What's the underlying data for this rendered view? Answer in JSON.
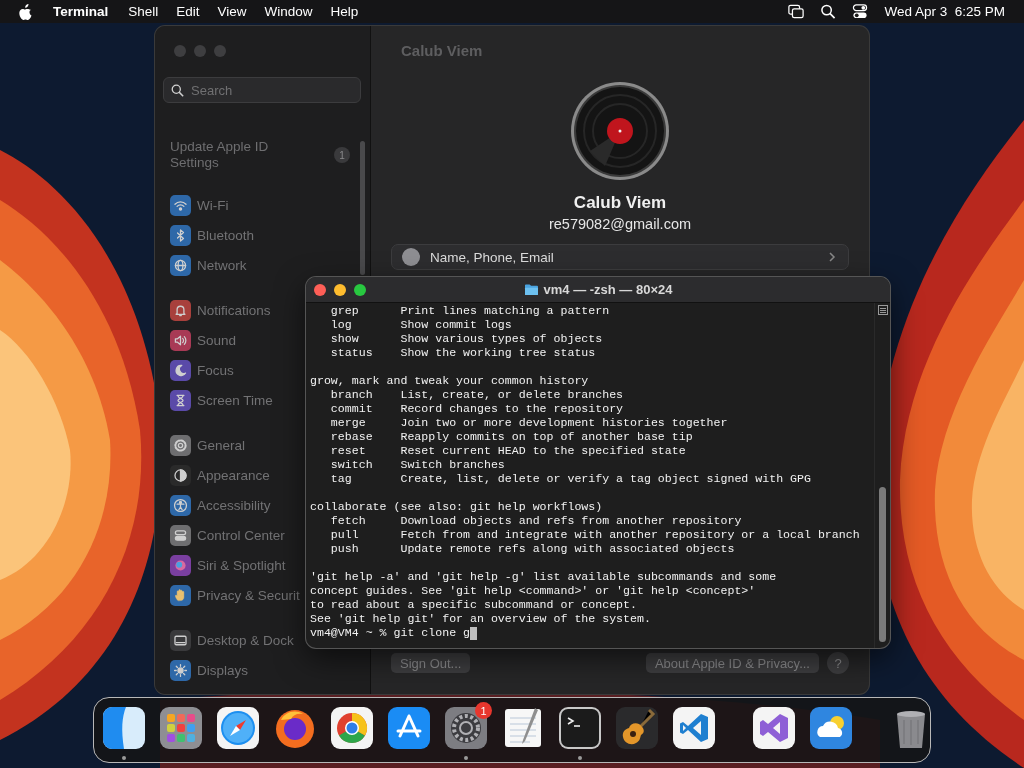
{
  "menu_bar": {
    "app": "Terminal",
    "menus": [
      "Shell",
      "Edit",
      "View",
      "Window",
      "Help"
    ],
    "clock": "Wed Apr 3  6:25 PM"
  },
  "settings_window": {
    "search": {
      "placeholder": "Search"
    },
    "account_item": {
      "label": "Update Apple ID Settings",
      "badge": "1"
    },
    "sidebar": {
      "groups": [
        [
          {
            "label": "Wi-Fi",
            "kind": "wifi",
            "color": "#2e68a8"
          },
          {
            "label": "Bluetooth",
            "kind": "bluetooth",
            "color": "#2e68a8"
          },
          {
            "label": "Network",
            "kind": "globe",
            "color": "#2e68a8"
          }
        ],
        [
          {
            "label": "Notifications",
            "kind": "bell",
            "color": "#a8403c"
          },
          {
            "label": "Sound",
            "kind": "speaker",
            "color": "#a83a55"
          },
          {
            "label": "Focus",
            "kind": "moon",
            "color": "#5a4aa8"
          },
          {
            "label": "Screen Time",
            "kind": "hourglass",
            "color": "#5a4aa8"
          }
        ],
        [
          {
            "label": "General",
            "kind": "gear",
            "color": "#6e6e70"
          },
          {
            "label": "Appearance",
            "kind": "contrast",
            "color": "#2a2a2a"
          },
          {
            "label": "Accessibility",
            "kind": "person",
            "color": "#2e68a8"
          },
          {
            "label": "Control Center",
            "kind": "toggles",
            "color": "#6e6e70"
          },
          {
            "label": "Siri & Spotlight",
            "kind": "orb",
            "color": "#7a3fa0"
          },
          {
            "label": "Privacy & Securit",
            "kind": "hand",
            "color": "#2e68a8"
          }
        ],
        [
          {
            "label": "Desktop & Dock",
            "kind": "dock",
            "color": "#3a3a3c"
          },
          {
            "label": "Displays",
            "kind": "sun",
            "color": "#2e68a8"
          }
        ]
      ]
    },
    "header_title": "Calub Viem",
    "profile": {
      "name": "Calub Viem",
      "email": "re579082@gmail.com"
    },
    "rows": [
      {
        "label": "Name, Phone, Email"
      }
    ],
    "buttons": [
      {
        "label": "Sign Out...",
        "kind": "left"
      },
      {
        "label": "About Apple ID & Privacy...",
        "kind": "right"
      },
      {
        "label": "?",
        "kind": "help"
      }
    ]
  },
  "terminal": {
    "title": "vm4 — -zsh — 80×24",
    "blocks": [
      [
        "   grep      Print lines matching a pattern",
        "   log       Show commit logs",
        "   show      Show various types of objects",
        "   status    Show the working tree status"
      ],
      [
        "grow, mark and tweak your common history",
        "   branch    List, create, or delete branches",
        "   commit    Record changes to the repository",
        "   merge     Join two or more development histories together",
        "   rebase    Reapply commits on top of another base tip",
        "   reset     Reset current HEAD to the specified state",
        "   switch    Switch branches",
        "   tag       Create, list, delete or verify a tag object signed with GPG"
      ],
      [
        "collaborate (see also: git help workflows)",
        "   fetch     Download objects and refs from another repository",
        "   pull      Fetch from and integrate with another repository or a local branch",
        "   push      Update remote refs along with associated objects"
      ],
      [
        "'git help -a' and 'git help -g' list available subcommands and some",
        "concept guides. See 'git help <command>' or 'git help <concept>'",
        "to read about a specific subcommand or concept.",
        "See 'git help git' for an overview of the system."
      ]
    ],
    "prompt": "vm4@VM4 ~ % git clone g"
  },
  "dock": {
    "items": [
      {
        "kind": "finder",
        "running": true
      },
      {
        "kind": "launchpad",
        "running": false
      },
      {
        "kind": "compass",
        "running": false
      },
      {
        "kind": "flame",
        "running": false
      },
      {
        "kind": "wheel",
        "running": false
      },
      {
        "kind": "store",
        "running": false
      },
      {
        "kind": "gear",
        "running": true,
        "badge": "1"
      },
      {
        "kind": "notepad",
        "running": false
      },
      {
        "kind": "terminal",
        "running": true
      },
      {
        "kind": "guitar",
        "running": false
      },
      {
        "kind": "code",
        "running": false
      },
      {
        "kind": "separator"
      },
      {
        "kind": "loop",
        "running": false
      },
      {
        "kind": "weather",
        "running": false
      },
      {
        "kind": "separator"
      },
      {
        "kind": "trash",
        "running": false
      }
    ]
  }
}
